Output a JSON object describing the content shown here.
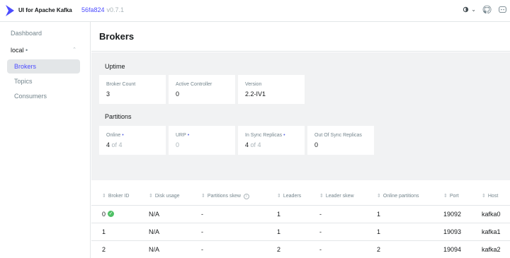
{
  "header": {
    "app_title": "UI for Apache Kafka",
    "version_hash": "56fa824",
    "version_tag": "v0.7.1",
    "theme_icon": "contrast-icon",
    "theme_caret": "⌄",
    "github_icon": "github-icon",
    "discord_icon": "discord-icon"
  },
  "sidebar": {
    "dashboard": "Dashboard",
    "cluster_name": "local",
    "cluster_status": "•",
    "cluster_caret": "⌃",
    "items": [
      {
        "label": "Brokers"
      },
      {
        "label": "Topics"
      },
      {
        "label": "Consumers"
      }
    ]
  },
  "page": {
    "title": "Brokers"
  },
  "uptime": {
    "title": "Uptime",
    "cards": [
      {
        "label": "Broker Count",
        "value": "3"
      },
      {
        "label": "Active Controller",
        "value": "0"
      },
      {
        "label": "Version",
        "value": "2.2-IV1"
      }
    ]
  },
  "partitions": {
    "title": "Partitions",
    "cards": [
      {
        "label": "Online",
        "arrow": "•",
        "value": "4",
        "suffix": "of 4"
      },
      {
        "label": "URP",
        "arrow": "•",
        "value": "0"
      },
      {
        "label": "In Sync Replicas",
        "arrow": "•",
        "value": "4",
        "suffix": "of 4"
      },
      {
        "label": "Out Of Sync Replicas",
        "value": "0"
      }
    ]
  },
  "table": {
    "sort_glyph": "⇕",
    "info_glyph": "i",
    "ok_glyph": "✓",
    "columns": [
      "Broker ID",
      "Disk usage",
      "Partitions skew",
      "Leaders",
      "Leader skew",
      "Online partitions",
      "Port",
      "Host"
    ],
    "rows": [
      {
        "id": "0",
        "disk": "N/A",
        "pskew": "-",
        "leaders": "1",
        "lskew": "-",
        "online": "1",
        "port": "19092",
        "host": "kafka0"
      },
      {
        "id": "1",
        "disk": "N/A",
        "pskew": "-",
        "leaders": "1",
        "lskew": "-",
        "online": "1",
        "port": "19093",
        "host": "kafka1"
      },
      {
        "id": "2",
        "disk": "N/A",
        "pskew": "-",
        "leaders": "2",
        "lskew": "-",
        "online": "2",
        "port": "19094",
        "host": "kafka2"
      }
    ]
  }
}
